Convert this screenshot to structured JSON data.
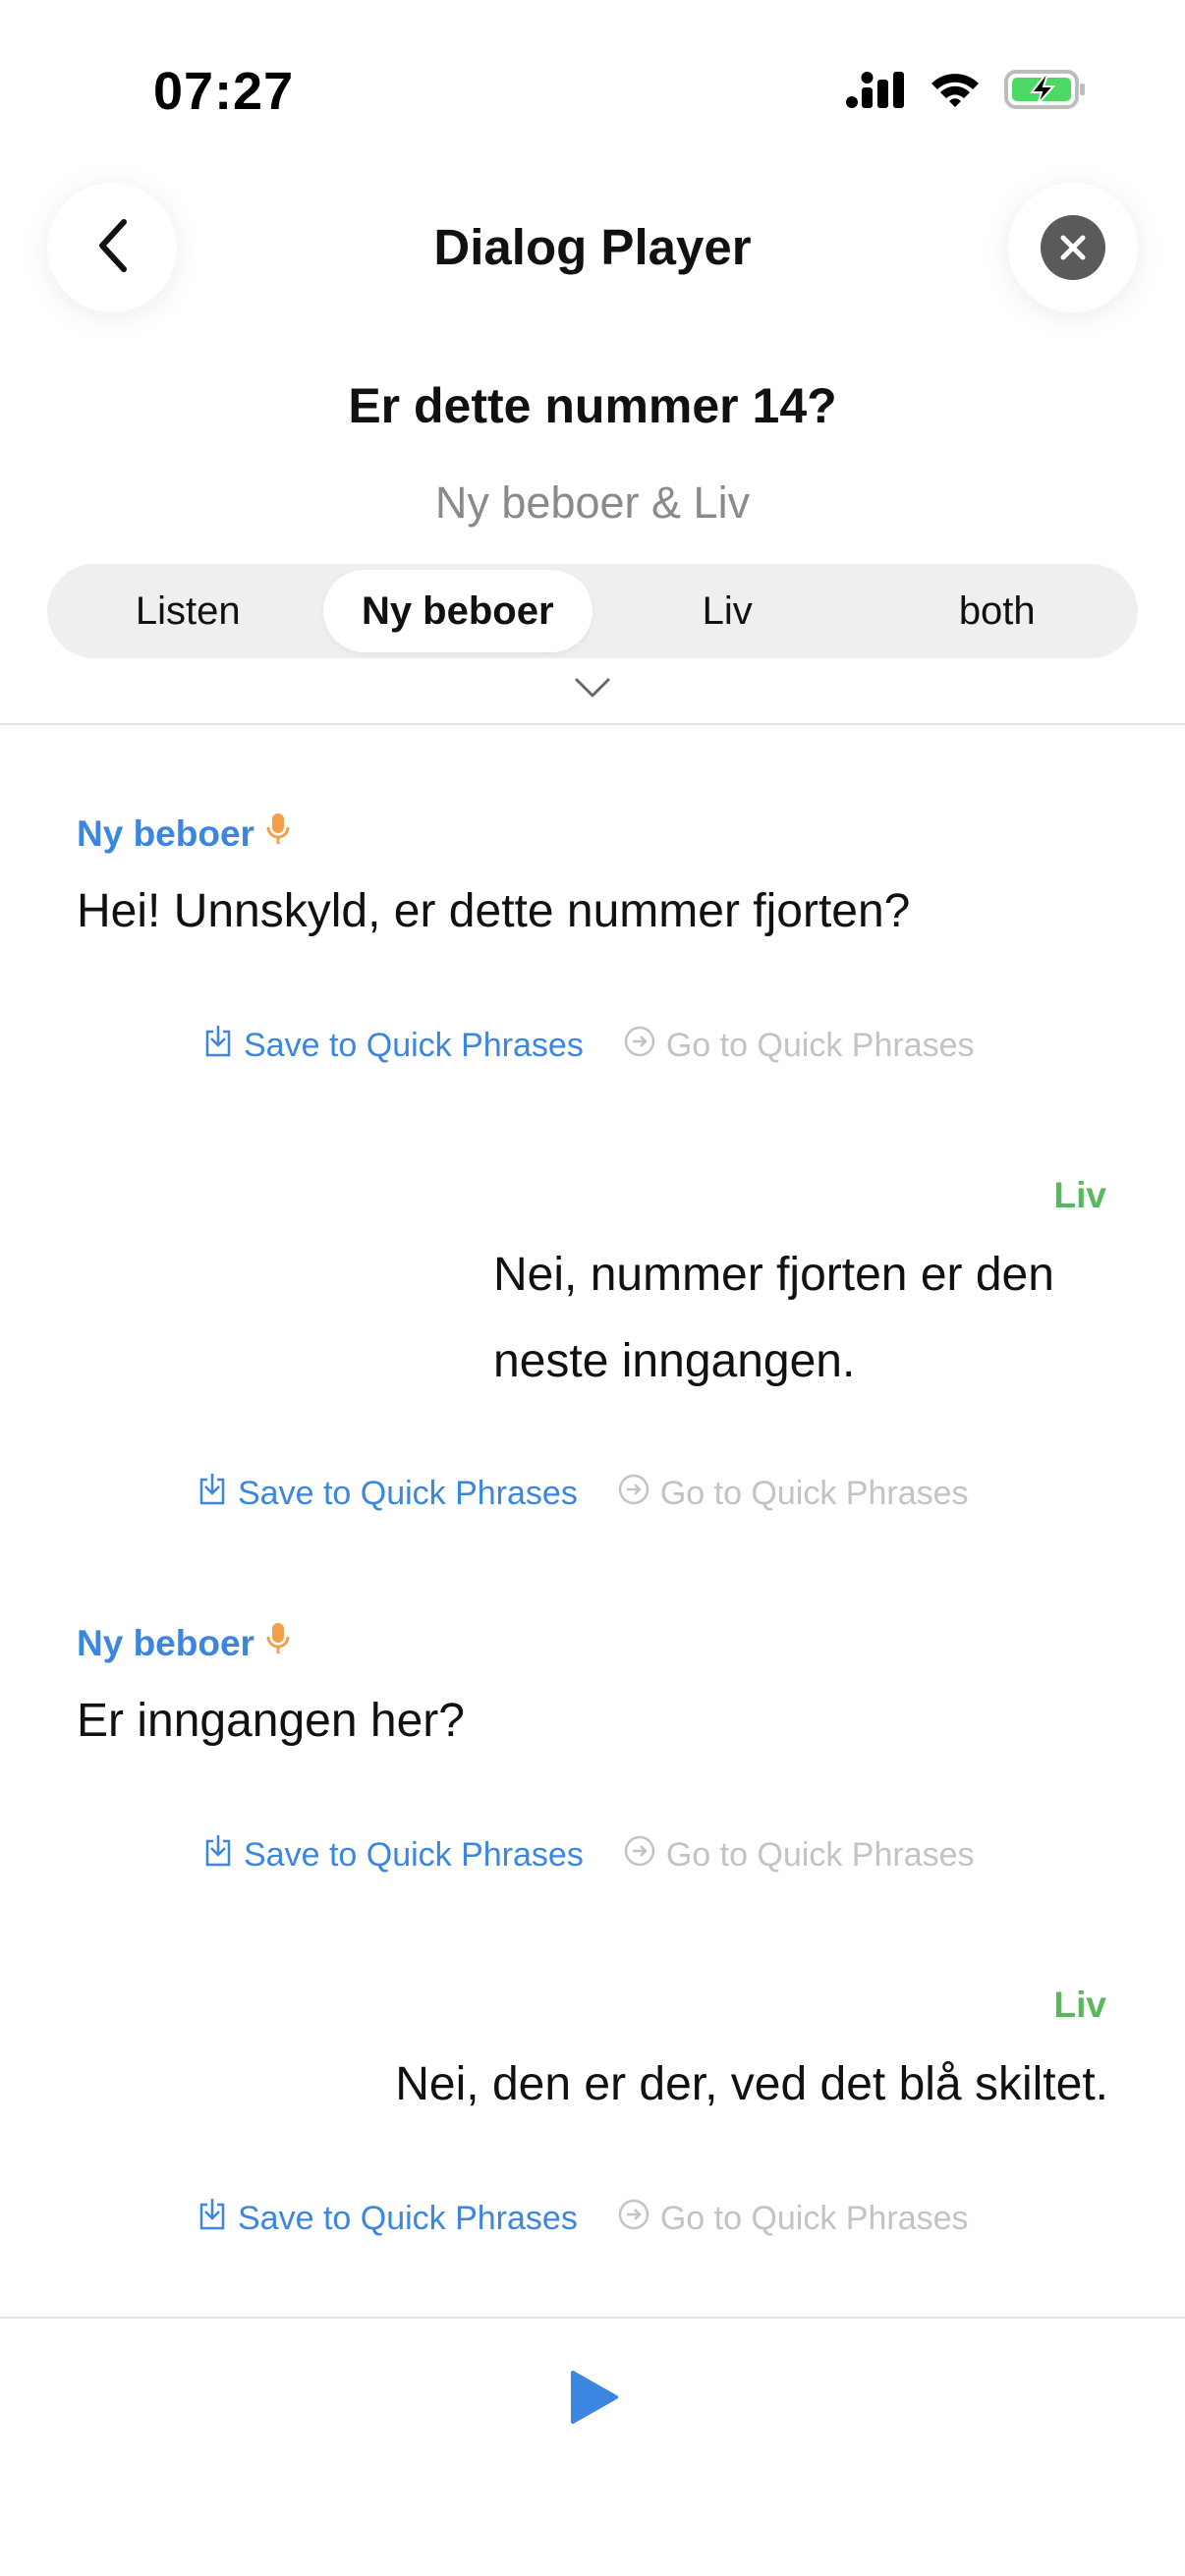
{
  "status_bar": {
    "time": "07:27"
  },
  "header": {
    "title": "Dialog Player"
  },
  "dialog": {
    "title": "Er dette nummer 14?",
    "subtitle": "Ny beboer & Liv"
  },
  "tabs": [
    {
      "label": "Listen",
      "active": false
    },
    {
      "label": "Ny beboer",
      "active": true
    },
    {
      "label": "Liv",
      "active": false
    },
    {
      "label": "both",
      "active": false
    }
  ],
  "actions": {
    "save_label": "Save to Quick Phrases",
    "go_label": "Go to Quick Phrases"
  },
  "messages": [
    {
      "speaker": "Ny beboer",
      "text": "Hei! Unnskyld, er dette nummer fjorten?",
      "align": "left"
    },
    {
      "speaker": "Liv",
      "text": "Nei, nummer fjorten er den neste inngangen.",
      "align": "right"
    },
    {
      "speaker": "Ny beboer",
      "text": "Er inngangen her?",
      "align": "left"
    },
    {
      "speaker": "Liv",
      "text": "Nei, den er der, ved det blå skiltet.",
      "align": "right"
    }
  ],
  "colors": {
    "accent_blue": "#3a86e0",
    "speaker_green": "#58b85c",
    "mic_orange": "#f0a048",
    "disabled": "#c3c3c7"
  }
}
